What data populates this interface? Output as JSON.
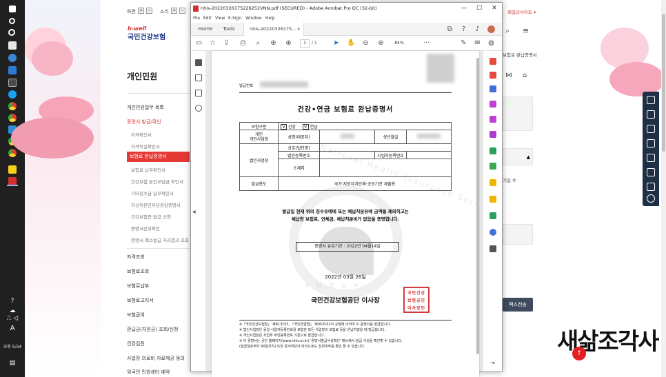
{
  "taskbar": {
    "time": "오후 5:54",
    "ime_label": "A",
    "app_icons": [
      "windows-icon",
      "search-icon",
      "cortana-icon",
      "edge-icon",
      "store-icon",
      "mail-icon",
      "twitter-icon",
      "chrome-icon",
      "chrome-icon",
      "files-icon",
      "chrome-icon",
      "chrome-icon",
      "yellow-app-icon",
      "acrobat-icon"
    ],
    "tray_icons": [
      "question-icon",
      "cloud-icon",
      "network-icon",
      "volume-icon"
    ]
  },
  "site": {
    "top_controls": {
      "zoom_label": "화면",
      "sound_label": "소리"
    },
    "logo_sub": "h-well",
    "logo_main": "국민건강보험",
    "top_right_text": "패밀리사이트",
    "heading": "개인민원",
    "menu": {
      "group1": "개인민원업무 목록",
      "group2": "증명서 발급/확인",
      "subitems": [
        "자격확인서",
        "자격득실확인서",
        "보험료 완납증명서",
        "보험료 납부확인서",
        "건강보험 본인부담금 확인서",
        "기타징수금 납부확인서",
        "차상위본인부담경감증명서",
        "건강보험증 발급 신청",
        "증명서진위확인",
        "증명서 팩스발급 처리결과 조회"
      ],
      "groups": [
        "자격조회",
        "보험료조회",
        "보험료납부",
        "보험료고지서",
        "보험급여",
        "환급금(지원금) 조회/신청",
        "건강검진",
        "사업장 의료비 자료제공 동의",
        "외국인 민원센터 예약"
      ]
    },
    "right": {
      "breadcrumb_tail": "보험료 완납증명서",
      "note_fragment": "기일 수",
      "fax_button": "팩스전송"
    },
    "signature_text": "새삶조각사",
    "up_button": "↑"
  },
  "acrobat": {
    "title": "nhis-20220326175226252VNN.pdf (SECURED) - Adobe Acrobat Pro DC (32-bit)",
    "window_buttons": {
      "minimize": "—",
      "maximize": "☐",
      "close": "✕"
    },
    "menus": [
      "File",
      "Edit",
      "View",
      "E-Sign",
      "Window",
      "Help"
    ],
    "tabs": {
      "home": "Home",
      "tools": "Tools",
      "doc": "nhis-2022032617S..."
    },
    "toolbar": {
      "page_current": "1",
      "page_total": "/ 1",
      "zoom": "84%",
      "more": "···"
    }
  },
  "certificate": {
    "issue_no_label": "발급번호",
    "title": "건강•연금 보험료 완납증명서",
    "insurance_type_label": "보험구분",
    "health_label": "건강",
    "pension_label": "연금",
    "checked": "V",
    "individual_business_label": "개인\n개인사업장",
    "name_label": "성명(대표자)",
    "birth_label": "생년월일",
    "corporate_label": "법인사업장",
    "company_name_label": "상호(법인명)",
    "corp_reg_label": "법인등록번호",
    "biz_reg_label": "사업자등록번호",
    "address_label": "소재지",
    "purpose_label": "발급용도",
    "purpose_value": "국가·지방자치단체·공공기관 제출용",
    "statement_line1": "발급일 현재 위의 징수유예에 또는 체납처분유예 금액을 제외하고는",
    "statement_line2": "체납한 보험료, 연체금, 체납처분비가 없음을 증명합니다.",
    "validity": "증명서 유효기간 : 2022년 04월14일",
    "issue_date": "2022년 03월 26일",
    "issuer": "국민건강보험공단 이사장",
    "seal_text": "국민건강보험공단이사장인",
    "footnotes": [
      "※「국민건강보험법」 제81조의3, 「국민연금법」 제95조의2의 규정에 의하여 이 증명서를 발급합니다.",
      "※ 법인사업장은 동일 사업자등록번호를 포함한 모든 사업장의 보험료 등을 완납하였을 때 발급합니다.",
      "※ 개인사업장은 사업주 주민등록번호 기준으로 발급합니다.",
      "※ 이 증명서는 공단 홈페이지(www.nhis.or.kr) '증명서발급사실확인' 메뉴에서 발급 사실을 확인할 수 있습니다.",
      "   (발급일로부터 90일까지) 또한 문서하단의 바코드로도 진위여부를 확인 할 수 있습니다."
    ],
    "watermark": "National Health Insurance Service",
    "watermark_bottom": "국 민 건 강 보"
  },
  "colors": {
    "accent_red": "#e53935",
    "navy": "#1f2f46",
    "acrobat_red": "#d32f2f"
  }
}
